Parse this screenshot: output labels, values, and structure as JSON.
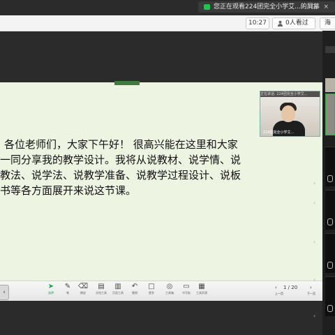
{
  "notification": {
    "text": "您正在观看224团完全小学艾...的屏幕",
    "controls": "– □ ×"
  },
  "meeting_bar": {
    "time": "10:27",
    "viewers": "0人看过",
    "more_label": "海"
  },
  "slide": {
    "lines": [
      "各位老师们，大家下午好！ 很高兴能在这里和大家",
      "一同分享我的教学设计。我将从说教材、说学情、说",
      "教法、说学法、说教学准备、说教学过程设计、说板",
      "书等各方面展开来说这节课。"
    ]
  },
  "camera": {
    "caption": "正在讲话: 224团完全小学艾...",
    "name": "224团完全小学艾..."
  },
  "toolbar": {
    "items": [
      {
        "glyph": "➤",
        "label": "选择"
      },
      {
        "glyph": "✎",
        "label": "笔"
      },
      {
        "glyph": "⌫",
        "label": "橡皮"
      },
      {
        "glyph": "▤",
        "label": "文档工具"
      },
      {
        "glyph": "▥",
        "label": "页面工具"
      },
      {
        "glyph": "↶",
        "label": "撤销"
      },
      {
        "glyph": "□",
        "label": "更多"
      },
      {
        "glyph": "◎",
        "label": "工具箱"
      },
      {
        "glyph": "▭",
        "label": "书写板"
      },
      {
        "glyph": "▦",
        "label": "工具资源"
      }
    ],
    "page_prev": "‹",
    "page_indicator": "1 / 20",
    "page_next": "›",
    "prev_label": "上一页",
    "next_label": "下一页"
  },
  "colors": {
    "slide_bg": "#edf4e2",
    "accent": "#1aa34a",
    "active_speaker": "#2fb34a"
  }
}
